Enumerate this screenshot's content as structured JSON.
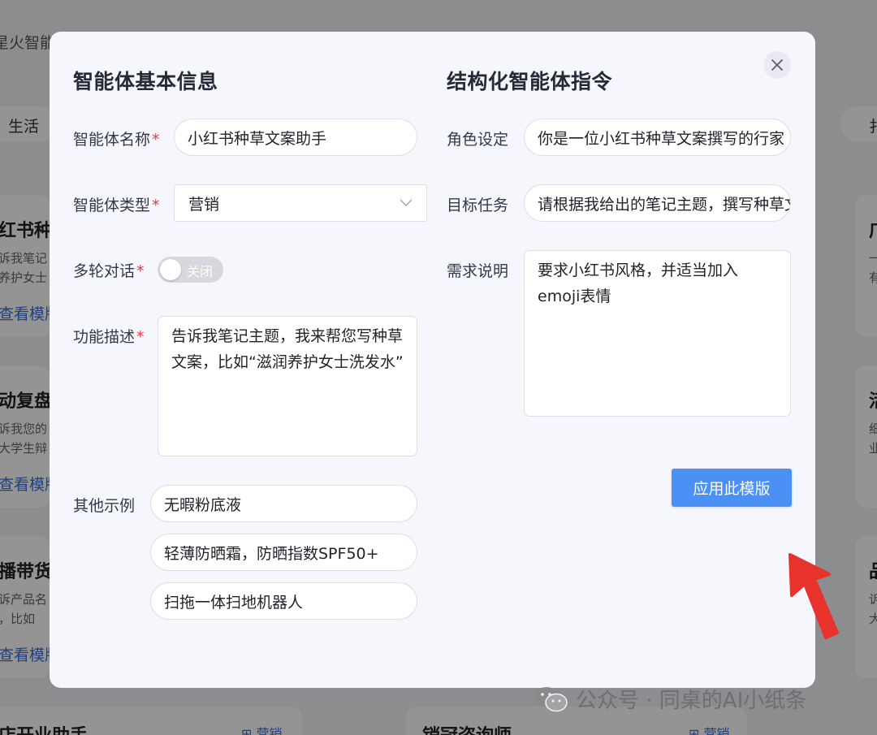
{
  "background": {
    "app_name": "星火智能",
    "category_tab": "生活",
    "right_edge_char": "扌",
    "cards_left": [
      {
        "title": "红书种",
        "desc1": "诉我笔记",
        "desc2": "养护女士",
        "link": "查看模版"
      },
      {
        "title": "动复盘",
        "desc1": "诉我您的",
        "desc2": "大学生辩",
        "link": "查看模版"
      },
      {
        "title": "播带货",
        "desc1": "诉产品名",
        "desc2": "，比如",
        "link": "查看模版"
      }
    ],
    "cards_right_chars": [
      {
        "title": "广",
        "desc1": "一",
        "desc2": "有"
      },
      {
        "title": "活",
        "desc1": "细",
        "desc2": "业"
      },
      {
        "title": "品",
        "desc1": "诉",
        "desc2": "大"
      }
    ],
    "bottom_cards": [
      {
        "title": "店开业助手",
        "tag": "营销"
      },
      {
        "title": "销冠咨询师",
        "tag": "营销"
      }
    ]
  },
  "modal": {
    "left_title": "智能体基本信息",
    "right_title": "结构化智能体指令",
    "fields": {
      "name": {
        "label": "智能体名称",
        "value": "小红书种草文案助手"
      },
      "type": {
        "label": "智能体类型",
        "value": "营销"
      },
      "multi_turn": {
        "label": "多轮对话",
        "toggle_text": "关闭",
        "enabled": false
      },
      "description": {
        "label": "功能描述",
        "value": "告诉我笔记主题，我来帮您写种草文案，比如“滋润养护女士洗发水”"
      },
      "examples": {
        "label": "其他示例",
        "items": [
          "无暇粉底液",
          "轻薄防晒霜，防晒指数SPF50+",
          "扫拖一体扫地机器人"
        ]
      }
    },
    "instructions": {
      "role": {
        "label": "角色设定",
        "value": "你是一位小红书种草文案撰写的行家"
      },
      "task": {
        "label": "目标任务",
        "value": "请根据我给出的笔记主题，撰写种草文案"
      },
      "requirement": {
        "label": "需求说明",
        "value": "要求小红书风格，并适当加入emoji表情"
      }
    },
    "apply_button": "应用此模版"
  },
  "watermark": {
    "text": "公众号 · 同桌的AI小纸条"
  },
  "colors": {
    "accent": "#4a90f5",
    "required": "#e23b3b",
    "arrow": "#e8322c"
  }
}
